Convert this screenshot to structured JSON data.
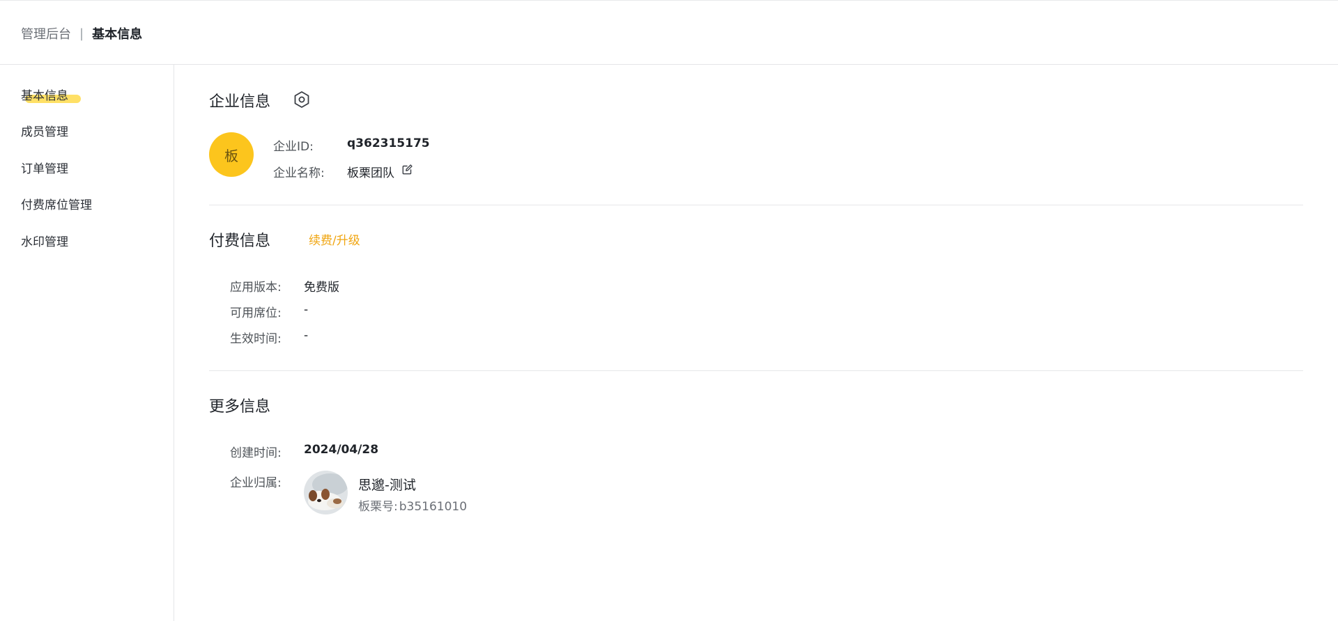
{
  "header": {
    "breadcrumb_root": "管理后台",
    "breadcrumb_separator": "|",
    "breadcrumb_current": "基本信息"
  },
  "sidebar": {
    "items": [
      {
        "label": "基本信息",
        "active": true
      },
      {
        "label": "成员管理",
        "active": false
      },
      {
        "label": "订单管理",
        "active": false
      },
      {
        "label": "付费席位管理",
        "active": false
      },
      {
        "label": "水印管理",
        "active": false
      }
    ]
  },
  "company": {
    "title": "企业信息",
    "settings_icon": "settings-hexagon-icon",
    "avatar_text": "板",
    "id_label": "企业ID:",
    "id_value": "q362315175",
    "name_label": "企业名称:",
    "name_value": "板栗团队",
    "edit_icon": "edit-icon"
  },
  "payment": {
    "title": "付费信息",
    "renew_link": "续费/升级",
    "version_label": "应用版本:",
    "version_value": "免费版",
    "seats_label": "可用席位:",
    "seats_value": "-",
    "effective_label": "生效时间:",
    "effective_value": "-"
  },
  "more": {
    "title": "更多信息",
    "created_label": "创建时间:",
    "created_value": "2024/04/28",
    "owner_label": "企业归属:",
    "owner_name": "思邈-测试",
    "owner_id_label": "板栗号:",
    "owner_id_value": "b35161010"
  },
  "colors": {
    "accent": "#fcc51d",
    "link": "#f0a510",
    "highlight": "#ffe066"
  }
}
